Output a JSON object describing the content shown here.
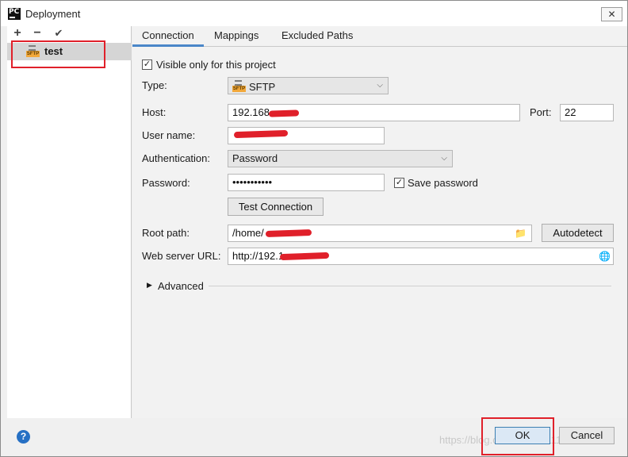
{
  "window": {
    "title": "Deployment",
    "app_icon_text": "PC",
    "close_symbol": "✕"
  },
  "sidebar": {
    "toolbar": {
      "add": "+",
      "remove": "−",
      "apply": "✔"
    },
    "servers": [
      {
        "name": "test",
        "type_icon": "sftp-icon",
        "icon_tag": "SFTP",
        "selected": true
      }
    ]
  },
  "tabs": [
    {
      "label": "Connection",
      "active": true
    },
    {
      "label": "Mappings",
      "active": false
    },
    {
      "label": "Excluded Paths",
      "active": false
    }
  ],
  "connection": {
    "visible_only_label": "Visible only for this project",
    "visible_only_checked": true,
    "type_label": "Type:",
    "type_value": "SFTP",
    "host_label": "Host:",
    "host_value": "192.168.",
    "port_label": "Port:",
    "port_value": "22",
    "username_label": "User name:",
    "username_value": "",
    "auth_label": "Authentication:",
    "auth_value": "Password",
    "password_label": "Password:",
    "password_value": "•••••••••••",
    "save_password_label": "Save password",
    "save_password_checked": true,
    "test_connection_label": "Test Connection",
    "root_path_label": "Root path:",
    "root_path_value": "/home/",
    "autodetect_label": "Autodetect",
    "web_url_label": "Web server URL:",
    "web_url_value": "http://192.1",
    "advanced_label": "Advanced"
  },
  "footer": {
    "help_symbol": "?",
    "ok_label": "OK",
    "cancel_label": "Cancel",
    "watermark": "https://blog.csdn.net/u011113817"
  },
  "colors": {
    "highlight_red": "#e0202a",
    "tab_accent": "#4a86c8",
    "selected_row": "#d5d5d5",
    "ok_button_bg": "#dbe8f5"
  }
}
